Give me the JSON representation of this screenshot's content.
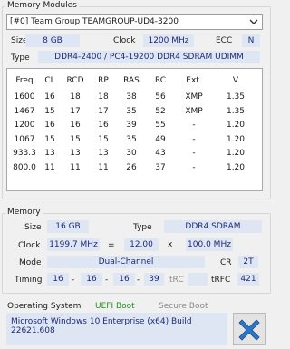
{
  "memory_modules": {
    "title": "Memory Modules",
    "selected_module": "[#0] Team Group TEAMGROUP-UD4-3200",
    "size_label": "Size",
    "size_value": "8 GB",
    "clock_label": "Clock",
    "clock_value": "1200 MHz",
    "ecc_label": "ECC",
    "ecc_value": "N",
    "type_label": "Type",
    "type_value": "DDR4-2400 / PC4-19200 DDR4 SDRAM UDIMM"
  },
  "spd_table": {
    "headers": [
      "Freq",
      "CL",
      "RCD",
      "RP",
      "RAS",
      "RC",
      "Ext.",
      "V"
    ],
    "rows": [
      [
        "1600",
        "16",
        "18",
        "18",
        "38",
        "56",
        "XMP",
        "1.35"
      ],
      [
        "1467",
        "15",
        "17",
        "17",
        "35",
        "52",
        "XMP",
        "1.35"
      ],
      [
        "1200",
        "16",
        "16",
        "16",
        "39",
        "55",
        "-",
        "1.20"
      ],
      [
        "1067",
        "15",
        "15",
        "15",
        "35",
        "49",
        "-",
        "1.20"
      ],
      [
        "933.3",
        "13",
        "13",
        "13",
        "30",
        "43",
        "-",
        "1.20"
      ],
      [
        "800.0",
        "11",
        "11",
        "11",
        "26",
        "37",
        "-",
        "1.20"
      ]
    ]
  },
  "memory": {
    "title": "Memory",
    "size_label": "Size",
    "size_value": "16 GB",
    "type_label": "Type",
    "type_value": "DDR4 SDRAM",
    "clock_label": "Clock",
    "clock_value": "1199.7 MHz",
    "equals": "=",
    "multiplier": "12.00",
    "times": "x",
    "base_clock": "100.0 MHz",
    "mode_label": "Mode",
    "mode_value": "Dual-Channel",
    "cr_label": "CR",
    "cr_value": "2T",
    "timing_label": "Timing",
    "timings": [
      "16",
      "16",
      "16",
      "39"
    ],
    "dash": "-",
    "trc_label": "tRC",
    "trfc_label": "tRFC",
    "trfc_value": "421"
  },
  "os": {
    "title": "Operating System",
    "uefi_boot": "UEFI Boot",
    "secure_boot": "Secure Boot",
    "os_name": "Microsoft Windows 10 Enterprise (x64) Build 22621.608"
  },
  "colors": {
    "field_bg": "#dfe6f3",
    "field_text": "#1c2a78",
    "uefi_green": "#1f8f1f",
    "disabled_gray": "#8a8a8a",
    "close_blue": "#2a77c9"
  },
  "icons": {
    "dropdown": "chevron-down-icon",
    "close": "close-x-icon"
  }
}
